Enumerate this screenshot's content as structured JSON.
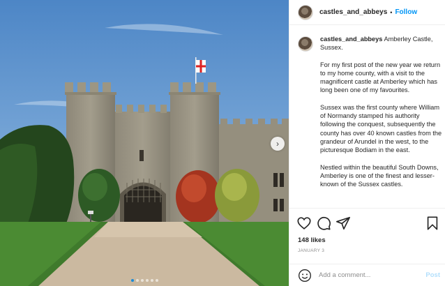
{
  "post": {
    "username": "castles_and_abbeys",
    "follow_label": "Follow",
    "separator": "•",
    "caption_location": "Amberley Castle, Sussex.",
    "caption_paragraphs": [
      "For my first post of the new year we return to my home county, with a visit to the magnificent castle at Amberley which has long been one of my favourites.",
      "Sussex was the first county where William of Normandy stamped his authority following the conquest, subsequently the county has over 40 known castles from the grandeur of Arundel in the west, to the picturesque Bodiam in the east.",
      "Nestled within the beautiful South Downs, Amberley is one of the finest and lesser-known of the Sussex castles."
    ],
    "likes": "148 likes",
    "date": "JANUARY 3",
    "comment_placeholder": "Add a comment...",
    "post_label": "Post"
  },
  "carousel": {
    "slide_count": 6,
    "active_index": 0,
    "next_icon": "chevron-right-icon"
  },
  "icons": [
    "heart-icon",
    "comment-icon",
    "share-icon",
    "bookmark-icon",
    "emoji-icon"
  ],
  "colors": {
    "link": "#0095f6",
    "post_disabled": "#b2dffc",
    "muted": "#8e8e8e",
    "text": "#262626"
  }
}
